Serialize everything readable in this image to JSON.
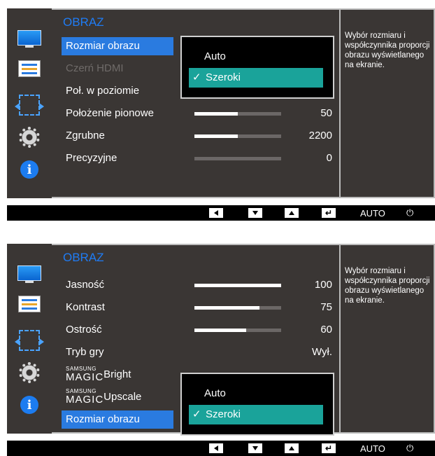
{
  "menu_title": "OBRAZ",
  "help_text": "Wybór rozmiaru i współczynnika proporcji obrazu wyświetlanego na ekranie.",
  "controls": {
    "auto_label": "AUTO",
    "power_glyph": "⏻",
    "enter_glyph": "↵"
  },
  "icons": [
    "monitor-icon",
    "menu-list-icon",
    "position-icon",
    "gear-icon",
    "info-icon"
  ],
  "colors": {
    "accent": "#2a7be0",
    "title": "#1f7cf5",
    "popup_selected": "#1aa39a",
    "panel_bg": "#3a3634"
  },
  "top_osd": {
    "rows": [
      {
        "label": "Rozmiar obrazu",
        "selected": true,
        "disabled": false
      },
      {
        "label": "Czerń HDMI",
        "disabled": true
      },
      {
        "label": "Poł. w poziomie"
      },
      {
        "label": "Położenie pionowe",
        "value": "50",
        "level": 0.5
      },
      {
        "label": "Zgrubne",
        "value": "2200",
        "level": 0.5
      },
      {
        "label": "Precyzyjne",
        "value": "0",
        "level": 0.0
      }
    ],
    "popup": {
      "options": [
        "Auto",
        "Szeroki"
      ],
      "selected": "Szeroki"
    }
  },
  "bottom_osd": {
    "rows": [
      {
        "label": "Jasność",
        "value": "100",
        "level": 1.0
      },
      {
        "label": "Kontrast",
        "value": "75",
        "level": 0.75
      },
      {
        "label": "Ostrość",
        "value": "60",
        "level": 0.6
      },
      {
        "label": "Tryb gry",
        "value": "Wył."
      },
      {
        "magic_small": "SAMSUNG",
        "magic_big": "MAGIC",
        "label": "Bright"
      },
      {
        "magic_small": "SAMSUNG",
        "magic_big": "MAGIC",
        "label": "Upscale"
      },
      {
        "label": "Rozmiar obrazu",
        "selected": true
      }
    ],
    "popup": {
      "options": [
        "Auto",
        "Szeroki"
      ],
      "selected": "Szeroki"
    }
  }
}
